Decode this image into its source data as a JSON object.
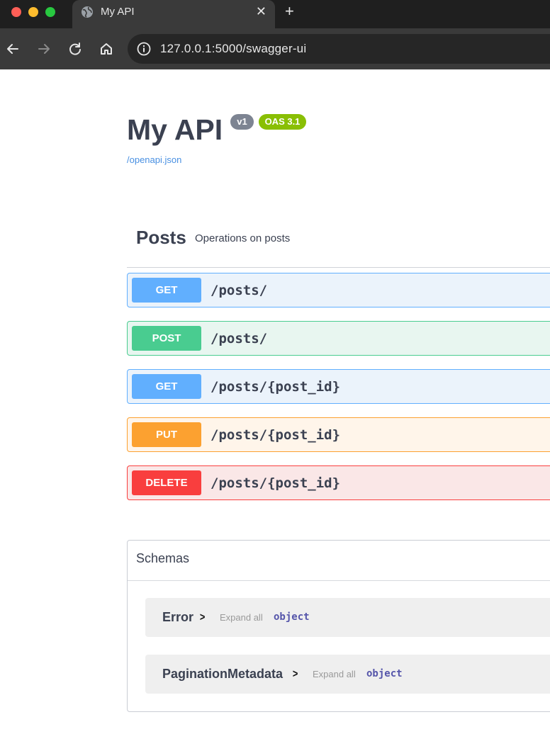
{
  "browser": {
    "tab_title": "My API",
    "close_glyph": "✕",
    "new_tab_glyph": "+",
    "url": "127.0.0.1:5000/swagger-ui"
  },
  "api": {
    "title": "My API",
    "version_badge": "v1",
    "oas_badge": "OAS 3.1",
    "spec_link": "/openapi.json"
  },
  "tag": {
    "name": "Posts",
    "description": "Operations on posts"
  },
  "operations": [
    {
      "method": "GET",
      "path": "/posts/"
    },
    {
      "method": "POST",
      "path": "/posts/"
    },
    {
      "method": "GET",
      "path": "/posts/{post_id}"
    },
    {
      "method": "PUT",
      "path": "/posts/{post_id}"
    },
    {
      "method": "DELETE",
      "path": "/posts/{post_id}"
    }
  ],
  "schemas": {
    "title": "Schemas",
    "models": [
      {
        "name": "Error",
        "expand": "Expand all",
        "type": "object"
      },
      {
        "name": "PaginationMetadata",
        "expand": "Expand all",
        "type": "object"
      }
    ]
  },
  "colors": {
    "get": "#61affe",
    "post": "#49cc90",
    "put": "#fca130",
    "delete": "#f93e3e",
    "oas_badge": "#89bf04",
    "version_badge": "#7d8492"
  }
}
